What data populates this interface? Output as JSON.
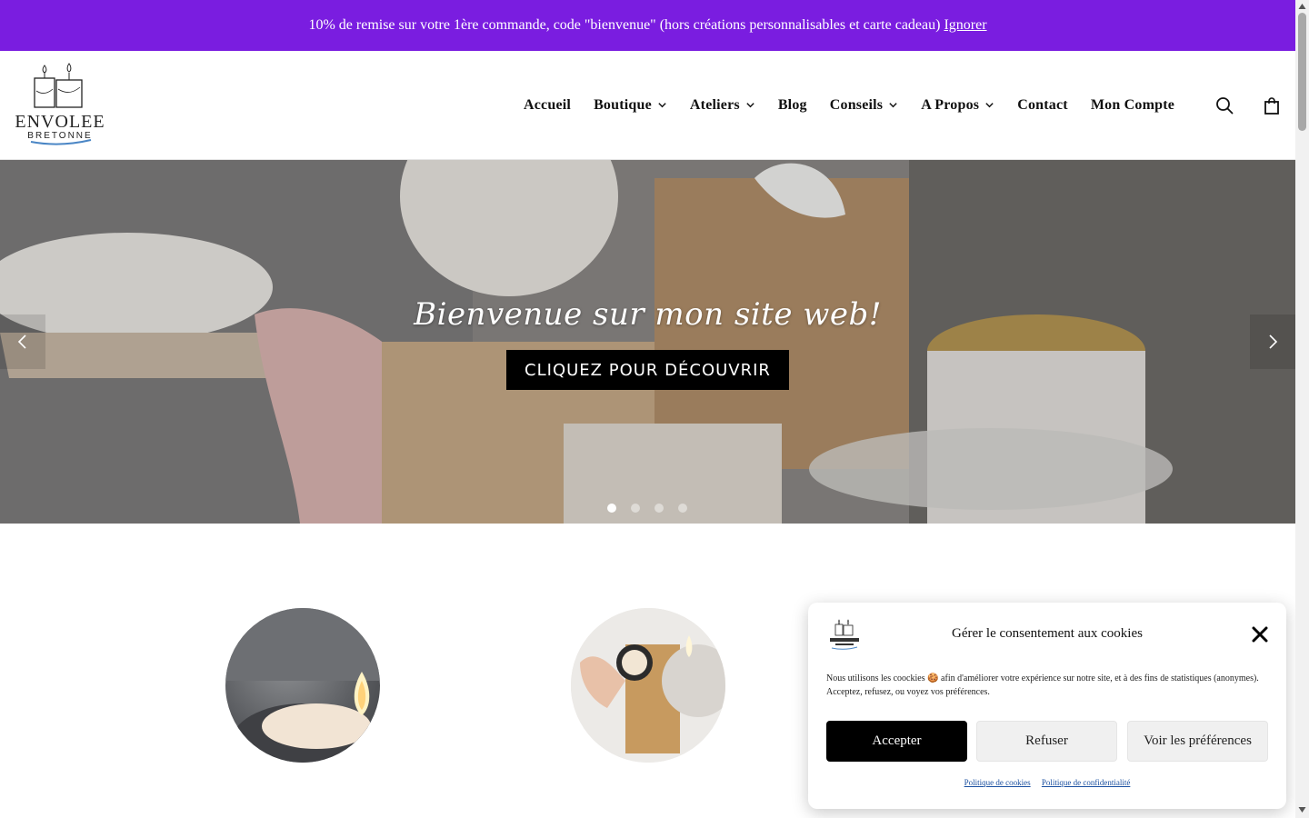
{
  "promo": {
    "text": "10% de remise sur votre 1ère commande, code \"bienvenue\" (hors créations personnalisables et carte cadeau)",
    "dismiss": "Ignorer"
  },
  "logo": {
    "line1": "ENVOLEE",
    "line2": "BRETONNE"
  },
  "nav": [
    {
      "label": "Accueil",
      "has_dropdown": false
    },
    {
      "label": "Boutique",
      "has_dropdown": true
    },
    {
      "label": "Ateliers",
      "has_dropdown": true
    },
    {
      "label": "Blog",
      "has_dropdown": false
    },
    {
      "label": "Conseils",
      "has_dropdown": true
    },
    {
      "label": "A Propos",
      "has_dropdown": true
    },
    {
      "label": "Contact",
      "has_dropdown": false
    },
    {
      "label": "Mon Compte",
      "has_dropdown": false
    }
  ],
  "header_icons": [
    "search-icon",
    "shopping-bag-icon"
  ],
  "hero": {
    "title": "Bienvenue sur mon site web!",
    "cta": "CLIQUEZ POUR DÉCOUVRIR",
    "slide_count": 4,
    "active_slide": 1
  },
  "cookie": {
    "title": "Gérer le consentement aux cookies",
    "text": "Nous utilisons les coockies 🍪 afin d'améliorer votre expérience sur notre site, et à des fins de statistiques (anonymes). Acceptez, refusez, ou voyez vos préférences.",
    "accept": "Accepter",
    "refuse": "Refuser",
    "preferences": "Voir les préférences",
    "link_cookies": "Politique de cookies",
    "link_privacy": "Politique de confidentialité"
  },
  "colors": {
    "promo_bg": "#7a1de0",
    "cta_bg": "#000000",
    "accept_bg": "#000000"
  }
}
